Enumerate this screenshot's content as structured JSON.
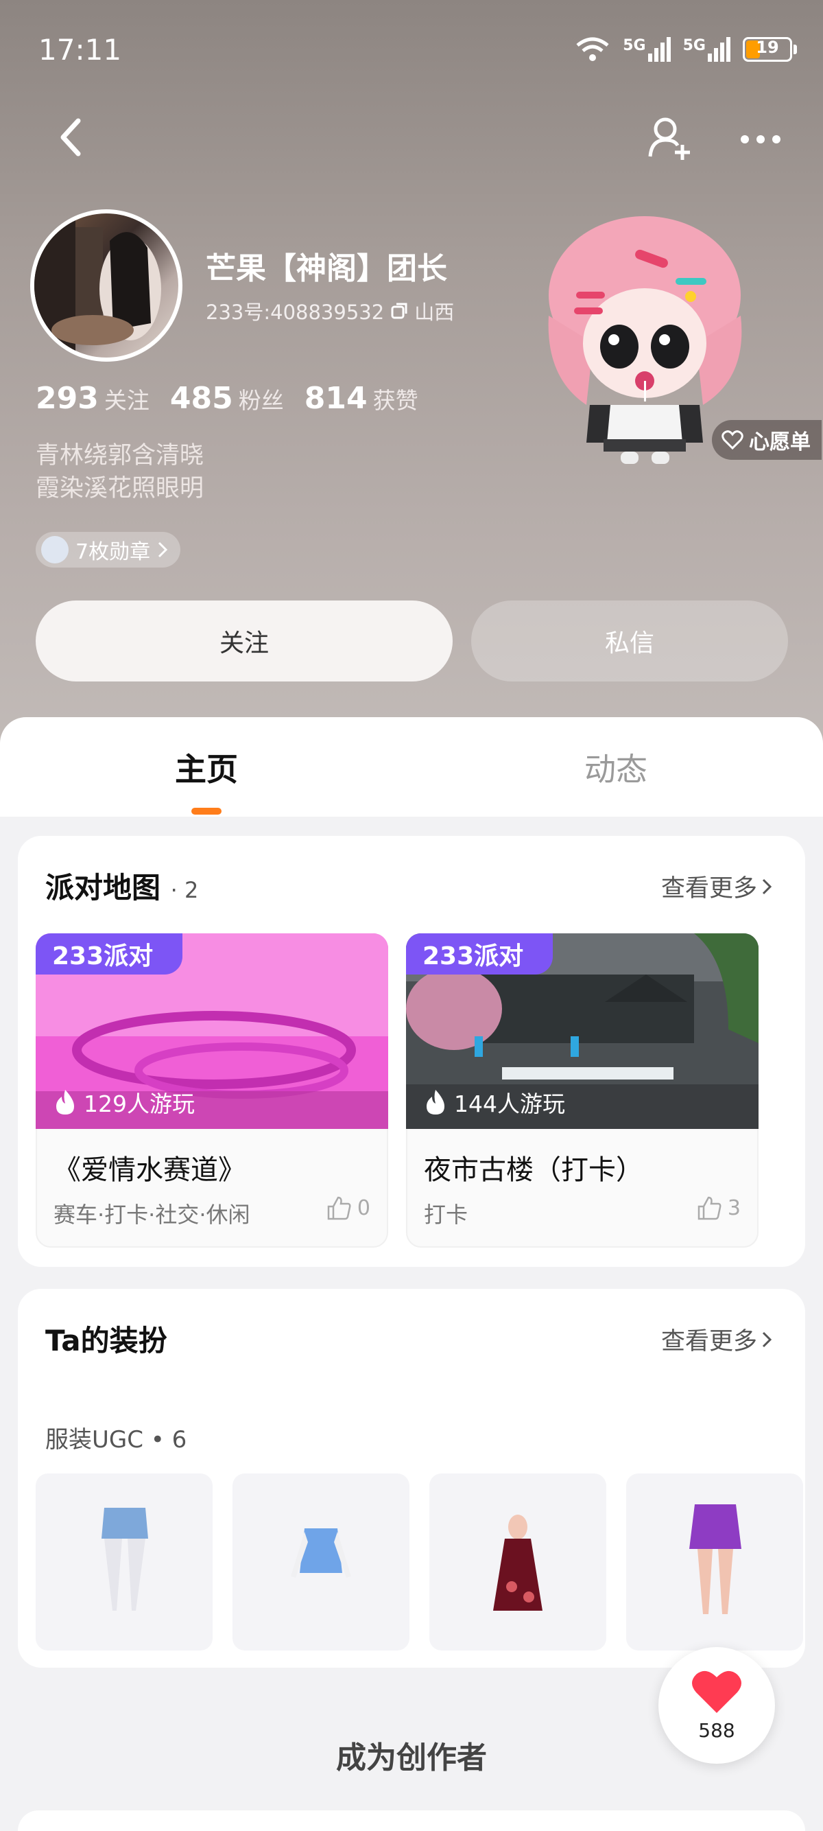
{
  "status": {
    "time": "17:11",
    "network1": "5G",
    "network2": "5G",
    "battery": "19"
  },
  "header": {
    "back_icon": "back-icon",
    "add_friend_icon": "add-friend-icon",
    "more_icon": "more-icon"
  },
  "profile": {
    "name": "芒果【神阁】团长",
    "id_label": "233号:408839532",
    "location": "山西",
    "stats": [
      {
        "num": "293",
        "label": "关注"
      },
      {
        "num": "485",
        "label": "粉丝"
      },
      {
        "num": "814",
        "label": "获赞"
      }
    ],
    "bio_line1": "青林绕郭含清晓",
    "bio_line2": "霞染溪花照眼明",
    "medals": "7枚勋章",
    "wishlist": "心愿单"
  },
  "actions": {
    "follow": "关注",
    "message": "私信"
  },
  "tabs": [
    {
      "label": "主页"
    },
    {
      "label": "动态"
    }
  ],
  "party_maps": {
    "title": "派对地图",
    "count": "· 2",
    "more": "查看更多",
    "items": [
      {
        "badge": "233派对",
        "plays": "129人游玩",
        "title": "《爱情水赛道》",
        "tags": "赛车·打卡·社交·休闲",
        "likes": "0"
      },
      {
        "badge": "233派对",
        "plays": "144人游玩",
        "title": "夜市古楼（打卡）",
        "tags": "打卡",
        "likes": "3"
      }
    ]
  },
  "outfits": {
    "title": "Ta的装扮",
    "more": "查看更多",
    "sub": "服装UGC • 6",
    "items": [
      {
        "icon": "jeans-shorts-outfit"
      },
      {
        "icon": "blue-top-outfit"
      },
      {
        "icon": "red-dress-outfit"
      },
      {
        "icon": "purple-skirt-outfit"
      }
    ]
  },
  "cta": "成为创作者",
  "like_count": "588"
}
